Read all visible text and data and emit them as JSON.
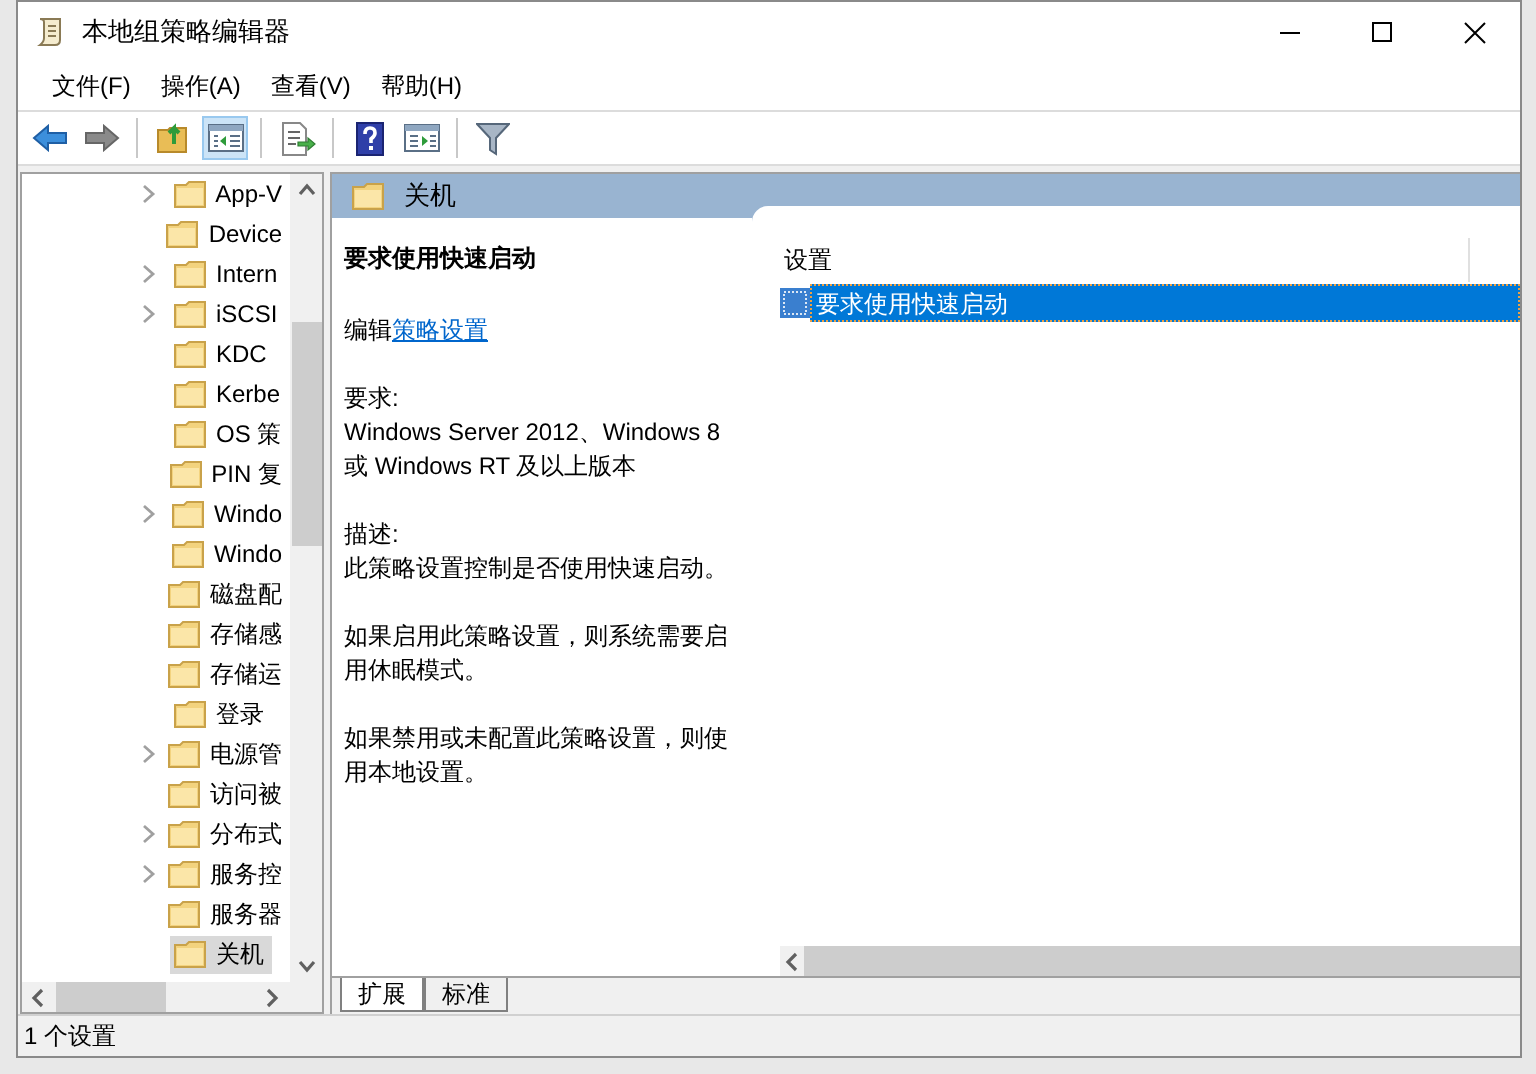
{
  "window": {
    "title": "本地组策略编辑器"
  },
  "menu": [
    {
      "label": "文件(F)"
    },
    {
      "label": "操作(A)"
    },
    {
      "label": "查看(V)"
    },
    {
      "label": "帮助(H)"
    }
  ],
  "toolbar": [
    {
      "items": [
        {
          "kind": "back",
          "selected": false
        },
        {
          "kind": "forward",
          "selected": false
        }
      ]
    },
    {
      "items": [
        {
          "kind": "up",
          "selected": false
        },
        {
          "kind": "tree",
          "selected": true
        }
      ]
    },
    {
      "items": [
        {
          "kind": "export",
          "selected": false
        }
      ]
    },
    {
      "items": [
        {
          "kind": "help",
          "selected": false
        },
        {
          "kind": "pane",
          "selected": false
        }
      ]
    },
    {
      "items": [
        {
          "kind": "filter",
          "selected": false
        }
      ]
    }
  ],
  "tree": {
    "items": [
      {
        "label": "App-V",
        "expandable": true,
        "selected": false
      },
      {
        "label": "Device",
        "expandable": false,
        "selected": false
      },
      {
        "label": "Intern",
        "expandable": true,
        "selected": false
      },
      {
        "label": "iSCSI",
        "expandable": true,
        "selected": false
      },
      {
        "label": "KDC",
        "expandable": false,
        "selected": false
      },
      {
        "label": "Kerbe",
        "expandable": false,
        "selected": false
      },
      {
        "label": "OS 策",
        "expandable": false,
        "selected": false
      },
      {
        "label": "PIN 复",
        "expandable": false,
        "selected": false
      },
      {
        "label": "Windo",
        "expandable": true,
        "selected": false
      },
      {
        "label": "Windo",
        "expandable": false,
        "selected": false
      },
      {
        "label": "磁盘配",
        "expandable": false,
        "selected": false
      },
      {
        "label": "存储感",
        "expandable": false,
        "selected": false
      },
      {
        "label": "存储运",
        "expandable": false,
        "selected": false
      },
      {
        "label": "登录",
        "expandable": false,
        "selected": false
      },
      {
        "label": "电源管",
        "expandable": true,
        "selected": false
      },
      {
        "label": "访问被",
        "expandable": false,
        "selected": false
      },
      {
        "label": "分布式",
        "expandable": true,
        "selected": false
      },
      {
        "label": "服务控",
        "expandable": true,
        "selected": false
      },
      {
        "label": "服务器",
        "expandable": false,
        "selected": false
      },
      {
        "label": "关机",
        "expandable": false,
        "selected": true
      }
    ]
  },
  "details": {
    "header": "关机",
    "title": "要求使用快速启动",
    "edit_prefix": "编辑",
    "edit_link": "策略设置",
    "requirements_label": "要求:",
    "requirements": "Windows Server 2012、Windows 8 或 Windows RT 及以上版本",
    "description_label": "描述:",
    "description": [
      "此策略设置控制是否使用快速启动。",
      "如果启用此策略设置，则系统需要启用休眠模式。",
      "如果禁用或未配置此策略设置，则使用本地设置。"
    ]
  },
  "list": {
    "column": "设置",
    "rows": [
      {
        "label": "要求使用快速启动",
        "selected": true
      }
    ]
  },
  "tabs": [
    {
      "label": "扩展",
      "selected": true
    },
    {
      "label": "标准",
      "selected": false
    }
  ],
  "status_bar": "1 个设置"
}
